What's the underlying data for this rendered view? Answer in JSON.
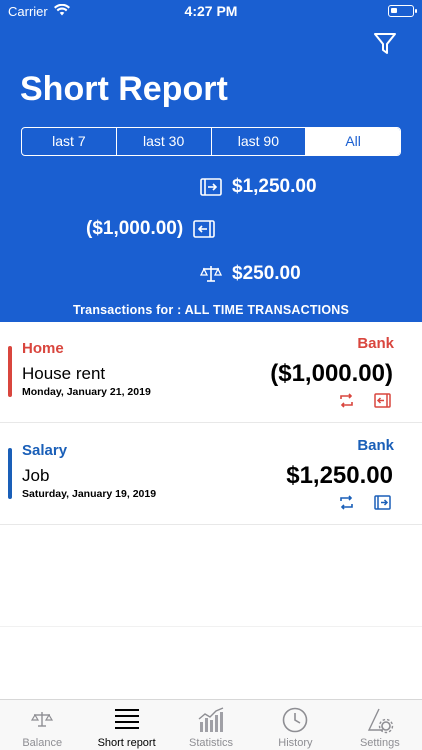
{
  "status_bar": {
    "carrier": "Carrier",
    "time": "4:27 PM"
  },
  "header": {
    "title": "Short Report",
    "filter_icon": "filter-funnel-icon",
    "segments": [
      {
        "label": "last 7",
        "selected": false
      },
      {
        "label": "last 30",
        "selected": false
      },
      {
        "label": "last 90",
        "selected": false
      },
      {
        "label": "All",
        "selected": true
      }
    ],
    "summary": {
      "income": "$1,250.00",
      "expense": "($1,000.00)",
      "balance": "$250.00"
    },
    "transactions_for": "Transactions for : ALL TIME TRANSACTIONS"
  },
  "transactions": [
    {
      "category": "Home",
      "account": "Bank",
      "name": "House rent",
      "amount": "($1,000.00)",
      "date": "Monday, January 21, 2019",
      "color": "#d9463e"
    },
    {
      "category": "Salary",
      "account": "Bank",
      "name": "Job",
      "amount": "$1,250.00",
      "date": "Saturday, January 19, 2019",
      "color": "#1a5fb8"
    }
  ],
  "tabbar": {
    "tabs": [
      {
        "label": "Balance",
        "icon": "scale-icon",
        "active": false
      },
      {
        "label": "Short report",
        "icon": "list-icon",
        "active": true
      },
      {
        "label": "Statistics",
        "icon": "chart-icon",
        "active": false
      },
      {
        "label": "History",
        "icon": "clock-icon",
        "active": false
      },
      {
        "label": "Settings",
        "icon": "settings-icon",
        "active": false
      }
    ]
  },
  "colors": {
    "brand_blue": "#1a5fd1",
    "expense_red": "#d9463e",
    "income_blue": "#1a5fb8"
  }
}
